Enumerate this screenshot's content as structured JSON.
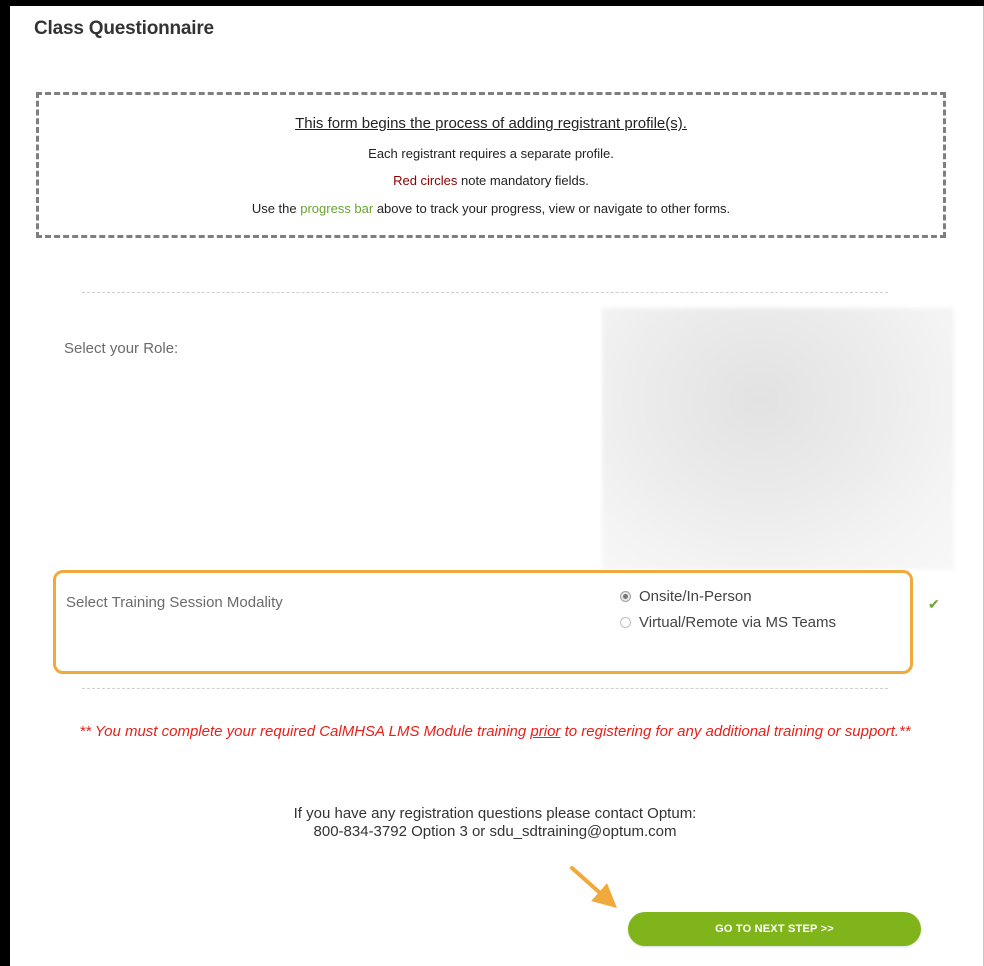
{
  "page": {
    "title": "Class Questionnaire"
  },
  "notice": {
    "heading": "This form begins the process of adding registrant profile(s).",
    "line1": "Each registrant requires a separate profile.",
    "line2_highlight": "Red circles",
    "line2_rest": " note mandatory fields.",
    "line3_before": "Use the ",
    "line3_highlight": "progress bar",
    "line3_after": " above to track your progress, view or navigate to other forms."
  },
  "form": {
    "role_label": "Select your Role:",
    "modality_label": "Select Training Session Modality",
    "modality_options": [
      {
        "label": "Onsite/In-Person",
        "selected": true
      },
      {
        "label": "Virtual/Remote via MS Teams",
        "selected": false
      }
    ],
    "check_mark": "✔"
  },
  "warning": {
    "before": "** You must complete your required CalMHSA LMS Module training ",
    "underlined": "prior",
    "after": " to registering for any additional training or support.**"
  },
  "contact": {
    "line1": "If you have any registration questions please contact Optum:",
    "line2": "800-834-3792 Option 3 or sdu_sdtraining@optum.com"
  },
  "actions": {
    "next_label": "GO TO NEXT STEP >>"
  },
  "colors": {
    "highlight_orange": "#f0a93b",
    "button_green": "#7fb51a",
    "warning_red": "#e8201a",
    "mandatory_red": "#8b0000",
    "progress_green": "#6aa531"
  }
}
